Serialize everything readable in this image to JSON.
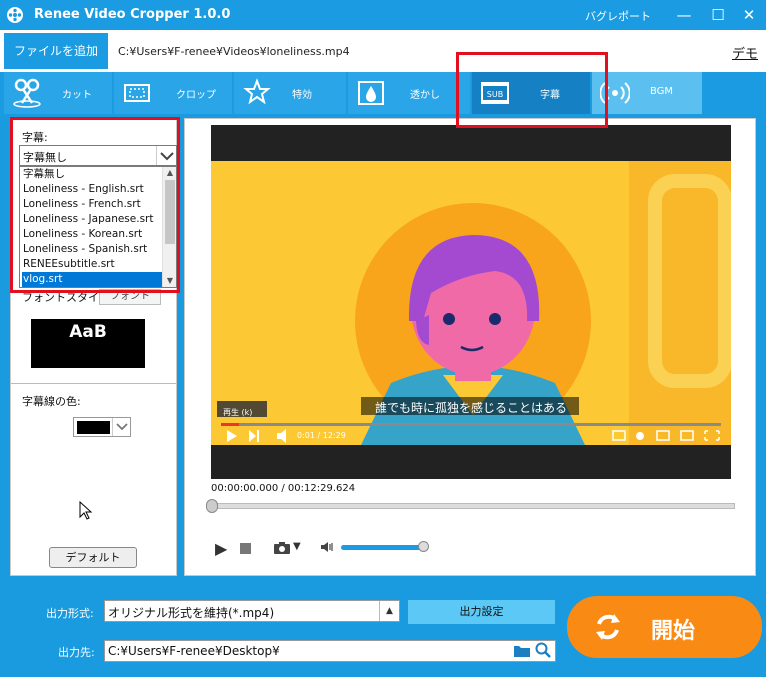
{
  "app": {
    "title": "Renee Video Cropper 1.0.0",
    "bug_report": "バグレポート"
  },
  "window_controls": {
    "minimize": "—",
    "maximize": "☐",
    "close": "✕"
  },
  "file_row": {
    "add_file": "ファイルを追加",
    "path": "C:¥Users¥F-renee¥Videos¥loneliness.mp4",
    "demo": "デモ"
  },
  "toolbar": {
    "items": [
      {
        "label": "カット",
        "icon": "scissors-icon"
      },
      {
        "label": "クロップ",
        "icon": "crop-icon"
      },
      {
        "label": "特効",
        "icon": "effects-icon"
      },
      {
        "label": "透かし",
        "icon": "watermark-icon"
      },
      {
        "label": "字幕",
        "icon": "subtitle-icon",
        "active": true
      },
      {
        "label": "BGM",
        "icon": "bgm-icon"
      }
    ]
  },
  "subtitle_panel": {
    "label": "字幕:",
    "selected_value": "字幕無し",
    "options": [
      "字幕無し",
      "Loneliness - English.srt",
      "Loneliness - French.srt",
      "Loneliness - Japanese.srt",
      "Loneliness - Korean.srt",
      "Loneliness - Spanish.srt",
      "RENEEsubtitle.srt",
      "vlog.srt"
    ],
    "highlighted_option": "vlog.srt",
    "font_style_label": "フォントスタイル:",
    "font_button": "フォント",
    "font_preview": "AaB",
    "outline_color_label": "字幕線の色:",
    "outline_color": "#000000",
    "default_button": "デフォルト"
  },
  "player": {
    "caption": "誰でも時に孤独を感じることはある",
    "video_label": "再生 (k)",
    "video_time": "0:01 / 12:29",
    "time_readout": "00:00:00.000 / 00:12:29.624",
    "volume_level": 0.95
  },
  "output": {
    "format_label": "出力形式:",
    "format_value": "オリジナル形式を維持(*.mp4)",
    "settings_button": "出力設定",
    "dest_label": "出力先:",
    "dest_value": "C:¥Users¥F-renee¥Desktop¥",
    "start_button": "開始"
  },
  "colors": {
    "accent": "#1b9ce2",
    "start": "#f98a14",
    "highlight": "#e0101f",
    "video_bg": "#fcc934"
  }
}
